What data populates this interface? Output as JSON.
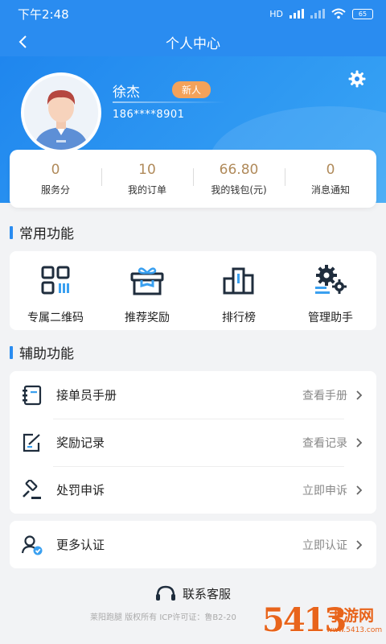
{
  "status_bar": {
    "time": "下午2:48",
    "network": "HD",
    "battery": "65"
  },
  "nav": {
    "title": "个人中心",
    "back_icon": "chevron-left-icon"
  },
  "profile": {
    "name": "徐杰",
    "badge": "新人",
    "phone": "186****8901"
  },
  "stats": [
    {
      "value": "0",
      "label": "服务分"
    },
    {
      "value": "10",
      "label": "我的订单"
    },
    {
      "value": "66.80",
      "label": "我的钱包(元)"
    },
    {
      "value": "0",
      "label": "消息通知"
    }
  ],
  "common_functions": {
    "title": "常用功能",
    "items": [
      {
        "label": "专属二维码",
        "icon": "qr-code-icon"
      },
      {
        "label": "推荐奖励",
        "icon": "gift-icon"
      },
      {
        "label": "排行榜",
        "icon": "ranking-icon"
      },
      {
        "label": "管理助手",
        "icon": "gears-icon"
      }
    ]
  },
  "aux_functions": {
    "title": "辅助功能",
    "items": [
      {
        "label": "接单员手册",
        "action": "查看手册",
        "icon": "handbook-icon"
      },
      {
        "label": "奖励记录",
        "action": "查看记录",
        "icon": "edit-record-icon"
      },
      {
        "label": "处罚申诉",
        "action": "立即申诉",
        "icon": "gavel-icon"
      }
    ]
  },
  "more_auth": {
    "label": "更多认证",
    "action": "立即认证",
    "icon": "user-verified-icon"
  },
  "contact": {
    "label": "联系客服",
    "icon": "headset-icon"
  },
  "footer": {
    "text": "莱阳跑腿 版权所有 ICP许可证：鲁B2-20"
  },
  "watermark": {
    "number": "5413",
    "title": "手游网",
    "url": "www.5413.com"
  },
  "colors": {
    "primary": "#2a8cf0",
    "badge": "#f4a25a",
    "stat_value": "#b08a5a",
    "icon_dark": "#1f2d3d",
    "icon_accent": "#3aa0f0"
  }
}
